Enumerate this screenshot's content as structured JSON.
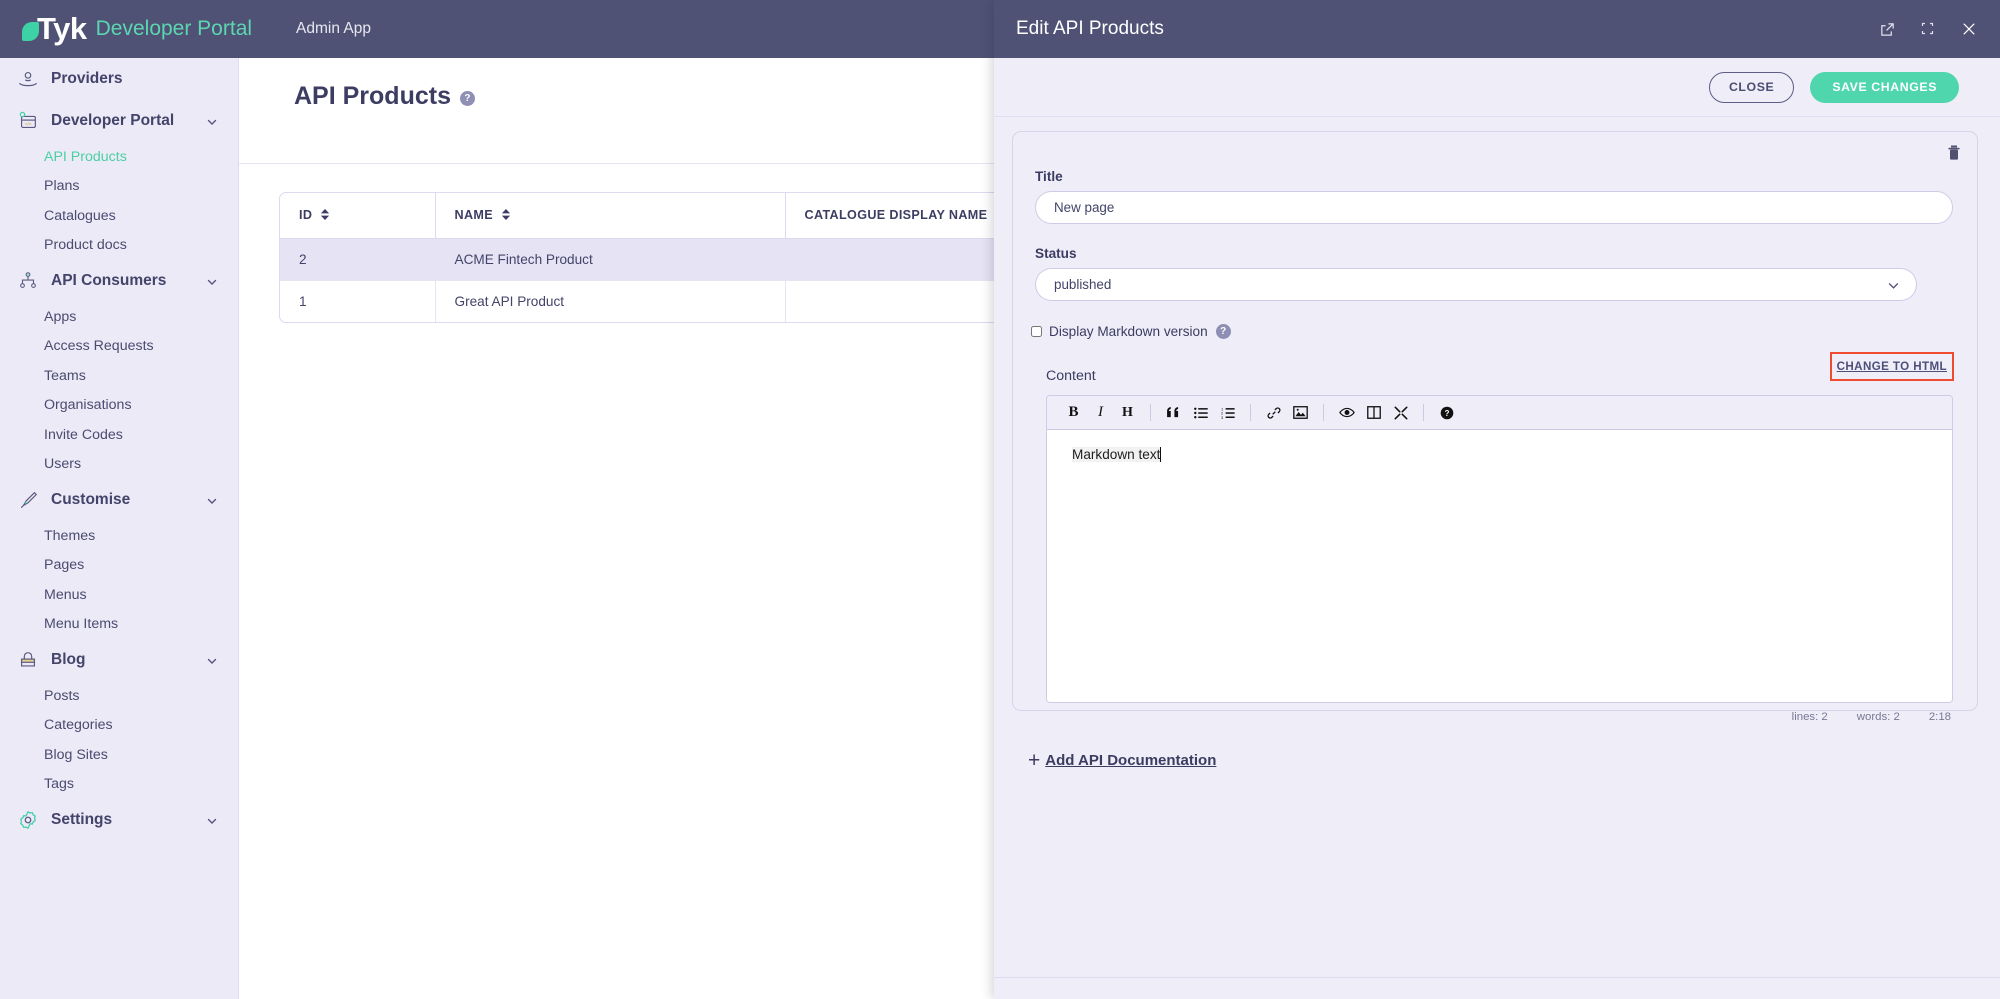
{
  "topbar": {
    "logo_brand": "Tyk",
    "logo_suffix": "Developer Portal",
    "app_name": "Admin App"
  },
  "sidebar": {
    "groups": [
      {
        "label": "Providers",
        "icon": "providers-icon",
        "collapsible": false,
        "items": []
      },
      {
        "label": "Developer Portal",
        "icon": "developer-portal-icon",
        "collapsible": true,
        "items": [
          {
            "label": "API Products",
            "active": true
          },
          {
            "label": "Plans",
            "active": false
          },
          {
            "label": "Catalogues",
            "active": false
          },
          {
            "label": "Product docs",
            "active": false
          }
        ]
      },
      {
        "label": "API Consumers",
        "icon": "api-consumers-icon",
        "collapsible": true,
        "items": [
          {
            "label": "Apps",
            "active": false
          },
          {
            "label": "Access Requests",
            "active": false
          },
          {
            "label": "Teams",
            "active": false
          },
          {
            "label": "Organisations",
            "active": false
          },
          {
            "label": "Invite Codes",
            "active": false
          },
          {
            "label": "Users",
            "active": false
          }
        ]
      },
      {
        "label": "Customise",
        "icon": "customise-icon",
        "collapsible": true,
        "items": [
          {
            "label": "Themes",
            "active": false
          },
          {
            "label": "Pages",
            "active": false
          },
          {
            "label": "Menus",
            "active": false
          },
          {
            "label": "Menu Items",
            "active": false
          }
        ]
      },
      {
        "label": "Blog",
        "icon": "blog-icon",
        "collapsible": true,
        "items": [
          {
            "label": "Posts",
            "active": false
          },
          {
            "label": "Categories",
            "active": false
          },
          {
            "label": "Blog Sites",
            "active": false
          },
          {
            "label": "Tags",
            "active": false
          }
        ]
      },
      {
        "label": "Settings",
        "icon": "settings-icon",
        "collapsible": true,
        "items": []
      }
    ]
  },
  "main": {
    "page_title": "API Products",
    "help_icon_char": "?",
    "table": {
      "columns": [
        "ID",
        "NAME",
        "CATALOGUE DISPLAY NAME"
      ],
      "rows": [
        {
          "id": "2",
          "name": "ACME Fintech Product",
          "catalogue_display_name": "",
          "selected": true
        },
        {
          "id": "1",
          "name": "Great API Product",
          "catalogue_display_name": "",
          "selected": false
        }
      ]
    }
  },
  "modal": {
    "title": "Edit API Products",
    "header_icons": [
      "external-link-icon",
      "expand-icon",
      "close-icon"
    ],
    "close_label": "CLOSE",
    "save_label": "SAVE CHANGES",
    "form": {
      "title_label": "Title",
      "title_value": "New page",
      "status_label": "Status",
      "status_value": "published",
      "markdown_checkbox_label": "Display Markdown version",
      "markdown_checkbox_checked": false,
      "markdown_help_char": "?",
      "content_label": "Content",
      "change_to_html_label": "CHANGE TO HTML",
      "delete_icon": "trash-icon"
    },
    "editor": {
      "toolbar": [
        {
          "name": "bold",
          "glyph": "B"
        },
        {
          "name": "italic",
          "glyph": "I"
        },
        {
          "name": "heading",
          "glyph": "H"
        },
        {
          "name": "quote",
          "glyph": "“"
        },
        {
          "name": "unordered-list",
          "glyph": "☰"
        },
        {
          "name": "ordered-list",
          "glyph": "☷"
        },
        {
          "name": "link",
          "glyph": "ὑ7"
        },
        {
          "name": "image",
          "glyph": "ὛC"
        },
        {
          "name": "preview",
          "glyph": "ὄ1"
        },
        {
          "name": "side-by-side",
          "glyph": "▥"
        },
        {
          "name": "fullscreen",
          "glyph": "✖"
        },
        {
          "name": "help",
          "glyph": "?"
        }
      ],
      "content": "Markdown text",
      "status_lines": "lines: 2",
      "status_words": "words: 2",
      "status_cursor": "2:18"
    },
    "add_documentation_label": "Add API Documentation",
    "add_documentation_plus": "+"
  },
  "colors": {
    "topbar_bg": "#4f5175",
    "sidebar_bg": "#eceaf7",
    "accent_green": "#4fd6ac",
    "active_nav": "#49cfa4",
    "highlight_red": "#f04a30",
    "modal_bg": "#eeedf8"
  }
}
